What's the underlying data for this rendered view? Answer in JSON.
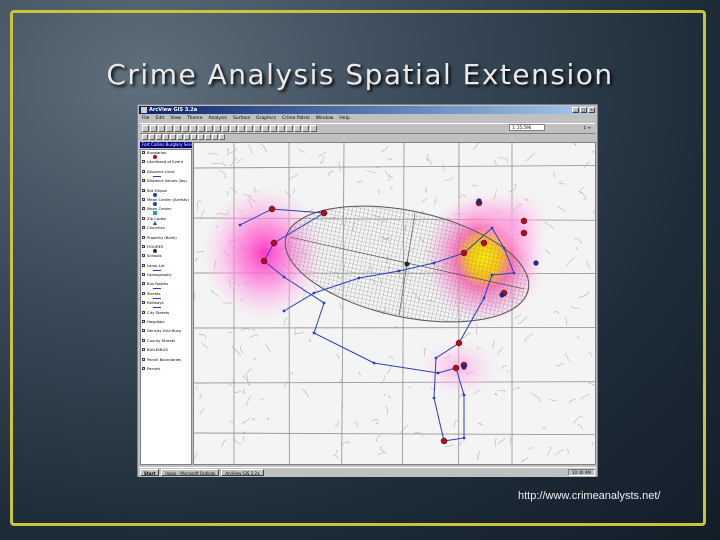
{
  "slide": {
    "title": "Crime Analysis Spatial Extension",
    "source_url": "http://www.crimeanalysts.net/"
  },
  "app": {
    "window_title": "ArcView GIS 3.2a",
    "menu": [
      "File",
      "Edit",
      "View",
      "Theme",
      "Analysis",
      "Surface",
      "Graphics",
      "Crime Patrol",
      "Window",
      "Help"
    ],
    "scale_value": "1: 25,596",
    "view_title": "Fort Collins Burglary Series View",
    "toc_layers": [
      {
        "label": "Burglaries",
        "checked": true,
        "symbol": "red-dot"
      },
      {
        "label": "Likelihood of Event",
        "checked": false,
        "symbol": "none"
      },
      {
        "label": "Distance Lines",
        "checked": true,
        "symbol": "blue-line"
      },
      {
        "label": "Distance Values (lbs)",
        "checked": true,
        "symbol": "none"
      },
      {
        "label": "Std Ellipse",
        "checked": true,
        "symbol": "blue-dot"
      },
      {
        "label": "Mean Center (Arrests)",
        "checked": false,
        "symbol": "blue-dot"
      },
      {
        "label": "Mean Center",
        "checked": false,
        "symbol": "cyan-square"
      },
      {
        "label": "Zip Codes",
        "checked": false,
        "symbol": "blue-triangle"
      },
      {
        "label": "Churches",
        "checked": false,
        "symbol": "none"
      },
      {
        "label": "Property (Bank)",
        "checked": false,
        "symbol": "none"
      },
      {
        "label": "FIGURES",
        "checked": false,
        "symbol": "dark-dot"
      },
      {
        "label": "Schools",
        "checked": false,
        "symbol": "none"
      },
      {
        "label": "Lamp Lat",
        "checked": false,
        "symbol": "blue-line"
      },
      {
        "label": "Hydrography",
        "checked": false,
        "symbol": "none"
      },
      {
        "label": "Bus Routes",
        "checked": false,
        "symbol": "blue-line"
      },
      {
        "label": "Streets",
        "checked": false,
        "symbol": "blue-line"
      },
      {
        "label": "Railways",
        "checked": false,
        "symbol": "blue-line"
      },
      {
        "label": "City Streets",
        "checked": true,
        "symbol": "none"
      },
      {
        "label": "Hospitals",
        "checked": false,
        "symbol": "none"
      },
      {
        "label": "Density Grid Burg",
        "checked": true,
        "symbol": "none"
      },
      {
        "label": "County Streets",
        "checked": false,
        "symbol": "none"
      },
      {
        "label": "BUILDINGS",
        "checked": false,
        "symbol": "none"
      },
      {
        "label": "Parcel Boundaries",
        "checked": false,
        "symbol": "none"
      },
      {
        "label": "Parcels",
        "checked": false,
        "symbol": "none"
      }
    ],
    "taskbar": {
      "start_label": "Start",
      "tasks": [
        "Inbox - Microsoft Outlook",
        "ArcView GIS 3.2a"
      ],
      "clock": "10:40 AM"
    },
    "colors": {
      "hotspot_core": "#ffe600",
      "hotspot_outer": "#ff4fc8",
      "event_point": "#b01020",
      "route_line": "#2a3fc0",
      "ellipse_hatch": "#8a8a8a"
    }
  }
}
